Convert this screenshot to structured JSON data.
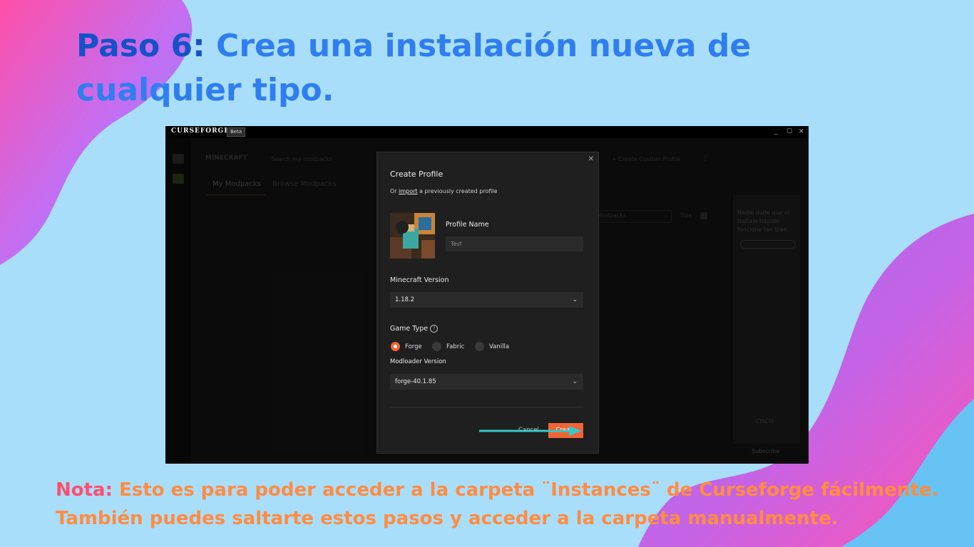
{
  "slide": {
    "title_lead": "Paso 6:",
    "title_rest": " Crea una instalación nueva de cualquier tipo.",
    "note_lead": "Nota:",
    "note_rest": " Esto es para poder acceder a la carpeta ¨Instances¨ de Curseforge fácilmente. También puedes saltarte estos pasos y acceder a la carpeta manualmente."
  },
  "colors": {
    "accent": "#f16436",
    "title_blue": "#2f7ef0",
    "note_orange": "#ff8c42",
    "bg": "#a9defb"
  },
  "app": {
    "brand": "CURSEFORGE",
    "badge": "Beta",
    "window_controls": {
      "minimize": "_",
      "maximize": "☐",
      "close": "✕"
    },
    "background": {
      "game_logo": "MINECRAFT",
      "search_placeholder": "Search my modpacks",
      "tab_my_modpacks": "My Modpacks",
      "tab_browse_modpacks": "Browse Modpacks",
      "create_custom_profile": "+ Create Custom Profile",
      "sort_select": "Modpacks",
      "size_label": "Size",
      "ad_text": "Nadie dude que el trabajo hibrido funcione tan bien",
      "ad_brand": "CISCO",
      "subscribe": "Subscribe"
    }
  },
  "dialog": {
    "title": "Create Profile",
    "import_prefix": "Or",
    "import_link": "import",
    "import_suffix": "a previously created profile",
    "profile_name_label": "Profile Name",
    "profile_name_placeholder": "Test",
    "minecraft_version_label": "Minecraft Version",
    "minecraft_version_value": "1.18.2",
    "game_type_label": "Game Type",
    "game_types": [
      "Forge",
      "Fabric",
      "Vanilla"
    ],
    "selected_game_type": "Forge",
    "modloader_version_label": "Modloader Version",
    "modloader_version_value": "forge-40.1.85",
    "cancel": "Cancel",
    "create": "Create",
    "close_icon": "✕"
  }
}
